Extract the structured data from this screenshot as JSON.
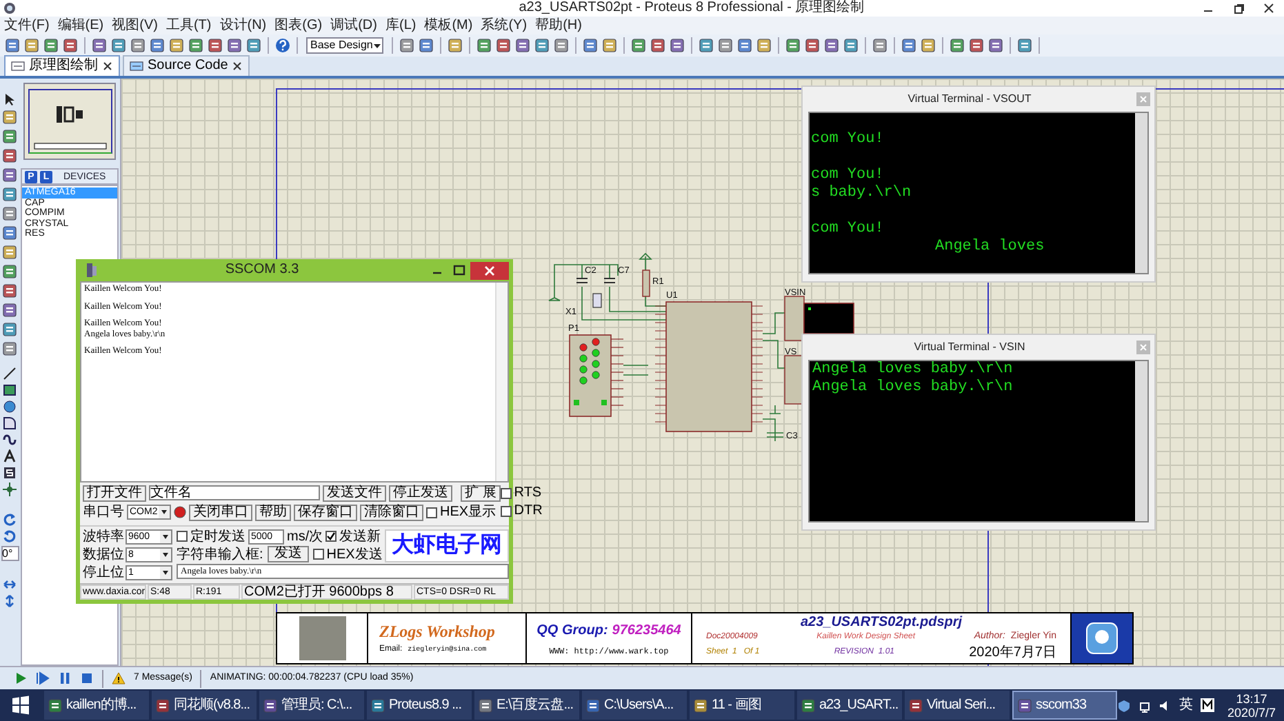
{
  "window": {
    "title": "a23_USARTS02pt - Proteus 8 Professional - 原理图绘制"
  },
  "menu": [
    "文件(F)",
    "编辑(E)",
    "视图(V)",
    "工具(T)",
    "设计(N)",
    "图表(G)",
    "调试(D)",
    "库(L)",
    "模板(M)",
    "系统(Y)",
    "帮助(H)"
  ],
  "toolbar": {
    "design_select": "Base Design"
  },
  "tabs": [
    {
      "label": "原理图绘制",
      "selected": true
    },
    {
      "label": "Source Code",
      "selected": false
    }
  ],
  "tool_strip": {
    "rotation": "0°"
  },
  "devices": {
    "buttons": [
      "P",
      "L"
    ],
    "title": "DEVICES",
    "items": [
      {
        "label": "ATMEGA16",
        "selected": true
      },
      {
        "label": "CAP",
        "selected": false
      },
      {
        "label": "COMPIM",
        "selected": false
      },
      {
        "label": "CRYSTAL",
        "selected": false
      },
      {
        "label": "RES",
        "selected": false
      }
    ]
  },
  "schematic": {
    "labels": [
      "C2",
      "C7",
      "R1",
      "U1",
      "VSIN",
      "X1",
      "P1",
      "VS",
      "C3"
    ]
  },
  "title_block": {
    "brand": "ZLogs Workshop",
    "email_label": "Email:",
    "email": "ziegleryin@sina.com",
    "qq_label": "QQ Group:",
    "qq_number": "976235464",
    "www": "WWW: http://www.wark.top",
    "project": "a23_USARTS02pt.pdsprj",
    "doc": "Doc20004009",
    "sheet_title": "Kaillen Work Design Sheet",
    "author_label": "Author:",
    "author": "Ziegler Yin",
    "sheet": "Sheet  1   Of 1",
    "revision": "REVISION  1.01",
    "date": "2020年7月7日"
  },
  "sscom": {
    "title": "SSCOM 3.3",
    "received": [
      [
        "Kaillen Welcom You!"
      ],
      [
        "Kaillen Welcom You!"
      ],
      [
        "Kaillen Welcom You!",
        "Angela loves baby.\\r\\n"
      ],
      [
        "Kaillen Welcom You!"
      ]
    ],
    "open_file": "打开文件",
    "file_name": "文件名",
    "send_file": "发送文件",
    "stop_send": "停止发送",
    "expand": "扩 展",
    "rts": {
      "label": "RTS",
      "checked": false
    },
    "dtr": {
      "label": "DTR",
      "checked": false
    },
    "port_label": "串口号",
    "port": "COM2",
    "close_port": "关闭串口",
    "help": "帮助",
    "save_window": "保存窗口",
    "clear_window": "清除窗口",
    "hex_display": {
      "label": "HEX显示",
      "checked": false
    },
    "baud_label": "波特率",
    "baud": "9600",
    "data_bits_label": "数据位",
    "data_bits": "8",
    "stop_bits_label": "停止位",
    "stop_bits": "1",
    "timed_send": {
      "label": "定时发送",
      "checked": false
    },
    "interval": "5000",
    "interval_unit": "ms/次",
    "send_newline": {
      "label": "发送新",
      "checked": true
    },
    "input_label": "字符串输入框:",
    "send": "发送",
    "hex_send": {
      "label": "HEX发送",
      "checked": false
    },
    "input": "Angela loves baby.\\r\\n",
    "logo": "大虾电子网",
    "status": [
      "www.daxia.cor",
      "S:48",
      "R:191",
      "COM2已打开 9600bps 8",
      "CTS=0 DSR=0 RL"
    ]
  },
  "vsout": {
    "title": "Virtual Terminal - VSOUT",
    "blocks": [
      [
        "com You!"
      ],
      [
        "com You!",
        "s baby.\\r\\n"
      ],
      [
        "com You!"
      ]
    ],
    "cursor_line": "Angela loves"
  },
  "vsin": {
    "title": "Virtual Terminal - VSIN",
    "lines": [
      "Angela loves baby.\\r\\n",
      "Angela loves baby.\\r\\n"
    ]
  },
  "status_bar": {
    "messages": "7 Message(s)",
    "animating": "ANIMATING: 00:00:04.782237 (CPU load 35%)"
  },
  "taskbar": {
    "items": [
      {
        "label": "kaillen的博...",
        "selected": false
      },
      {
        "label": "同花顺(v8.8...",
        "selected": false
      },
      {
        "label": "管理员: C:\\...",
        "selected": false
      },
      {
        "label": "Proteus8.9 ...",
        "selected": false
      },
      {
        "label": "E:\\百度云盘...",
        "selected": false
      },
      {
        "label": "C:\\Users\\A...",
        "selected": false
      },
      {
        "label": "11 - 画图",
        "selected": false
      },
      {
        "label": "a23_USART...",
        "selected": false
      },
      {
        "label": "Virtual Seri...",
        "selected": false
      },
      {
        "label": "sscom33",
        "selected": true
      }
    ],
    "ime": "英",
    "time": "13:17",
    "date": "2020/7/7"
  }
}
